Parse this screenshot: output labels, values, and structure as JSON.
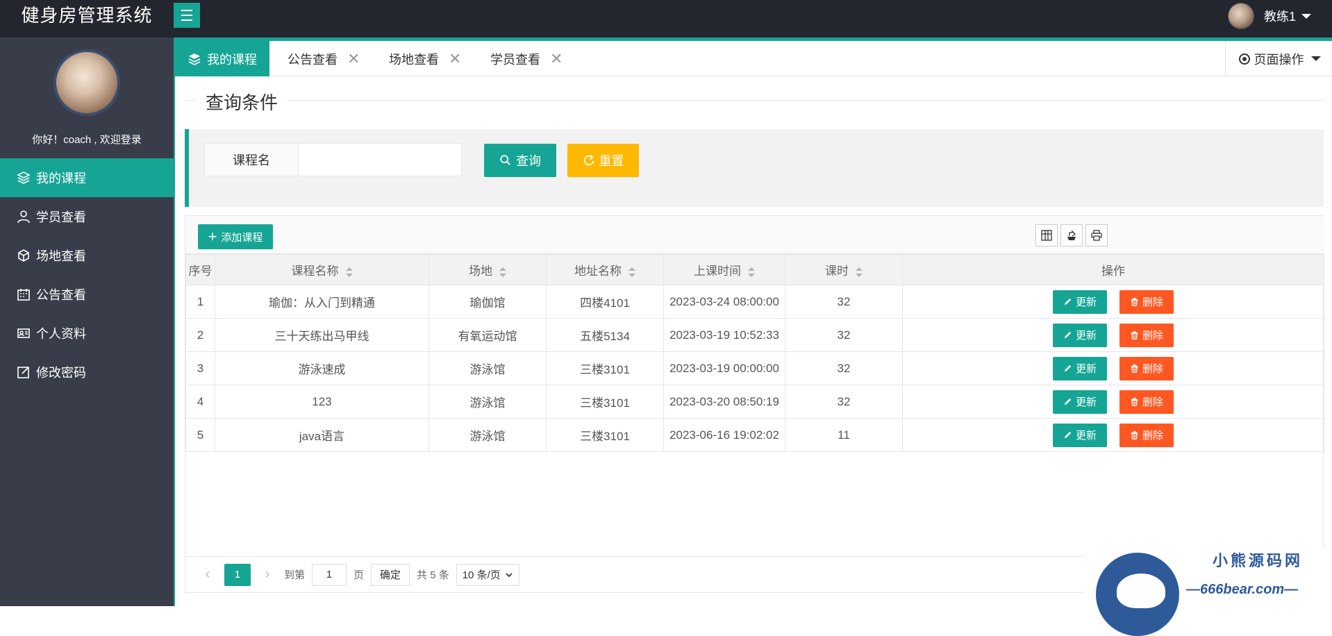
{
  "app": {
    "title": "健身房管理系统"
  },
  "header": {
    "username": "教练1"
  },
  "sidebar": {
    "greeting": "你好！coach , 欢迎登录",
    "items": [
      {
        "label": "我的课程",
        "icon": "layers-icon",
        "active": true
      },
      {
        "label": "学员查看",
        "icon": "user-icon",
        "active": false
      },
      {
        "label": "场地查看",
        "icon": "cube-icon",
        "active": false
      },
      {
        "label": "公告查看",
        "icon": "calendar-icon",
        "active": false
      },
      {
        "label": "个人资料",
        "icon": "id-card-icon",
        "active": false
      },
      {
        "label": "修改密码",
        "icon": "edit-icon",
        "active": false
      }
    ]
  },
  "tabs": [
    {
      "label": "我的课程",
      "active": true
    },
    {
      "label": "公告查看",
      "active": false
    },
    {
      "label": "场地查看",
      "active": false
    },
    {
      "label": "学员查看",
      "active": false
    }
  ],
  "page_ops": "页面操作",
  "query": {
    "legend": "查询条件",
    "field_label": "课程名",
    "field_value": "",
    "search_label": "查询",
    "reset_label": "重置"
  },
  "toolbar": {
    "add_label": "添加课程"
  },
  "table": {
    "columns": [
      "序号",
      "课程名称",
      "场地",
      "地址名称",
      "上课时间",
      "课时",
      "操作"
    ],
    "rows": [
      [
        "1",
        "瑜伽：从入门到精通",
        "瑜伽馆",
        "四楼4101",
        "2023-03-24 08:00:00",
        "32"
      ],
      [
        "2",
        "三十天练出马甲线",
        "有氧运动馆",
        "五楼5134",
        "2023-03-19 10:52:33",
        "32"
      ],
      [
        "3",
        "游泳速成",
        "游泳馆",
        "三楼3101",
        "2023-03-19 00:00:00",
        "32"
      ],
      [
        "4",
        "123",
        "游泳馆",
        "三楼3101",
        "2023-03-20 08:50:19",
        "32"
      ],
      [
        "5",
        "java语言",
        "游泳馆",
        "三楼3101",
        "2023-06-16 19:02:02",
        "11"
      ]
    ],
    "update_label": "更新",
    "delete_label": "删除"
  },
  "pager": {
    "current": "1",
    "goto_label": "到第",
    "goto_value": "1",
    "page_unit": "页",
    "confirm_label": "确定",
    "total": "共 5 条",
    "per_page": "10 条/页"
  },
  "watermark": {
    "name": "小熊源码网",
    "url": "—666bear.com—"
  },
  "colors": {
    "accent": "#16a595",
    "warning": "#ffb800",
    "danger": "#ff5722",
    "sidebar": "#393d49",
    "header": "#23262e"
  }
}
